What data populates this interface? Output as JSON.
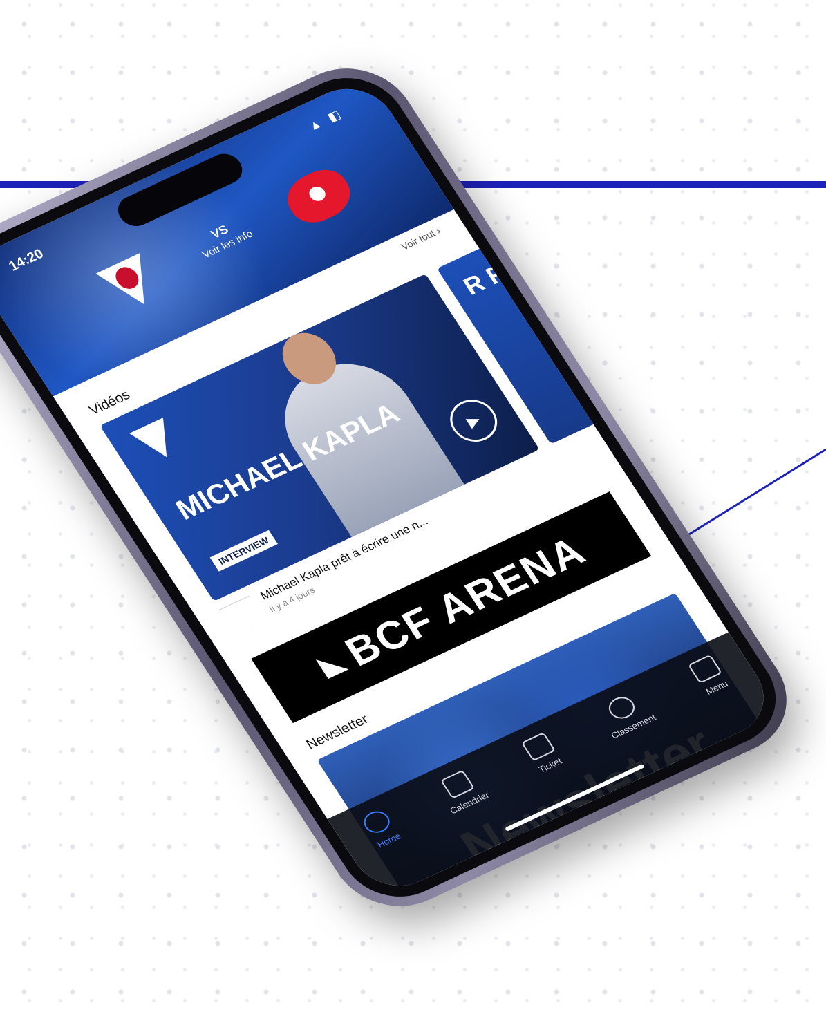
{
  "status": {
    "time": "14:20",
    "icons": "▲ ◧"
  },
  "match": {
    "line1": "VS",
    "line2": "Voir les info"
  },
  "videos": {
    "see_all": "Voir tout ›",
    "section_title": "Vidéos",
    "items": [
      {
        "headline": "MICHAEL KAPLA",
        "tag": "INTERVIEW",
        "title": "Michael Kapla prêt à écrire une n...",
        "time": "Il y a 4 jours"
      },
      {
        "headline": "R R"
      }
    ]
  },
  "sponsor": {
    "name": "BCF ARENA"
  },
  "newsletter": {
    "section_title": "Newsletter",
    "card_label": "Newsletter"
  },
  "tabs": [
    {
      "label": "Home"
    },
    {
      "label": "Calendrier"
    },
    {
      "label": "Ticket"
    },
    {
      "label": "Classement"
    },
    {
      "label": "Menu"
    }
  ],
  "colors": {
    "accent_line": "#1d22b8",
    "team_blue": "#1f57c4",
    "opponent_red": "#e4172d"
  }
}
